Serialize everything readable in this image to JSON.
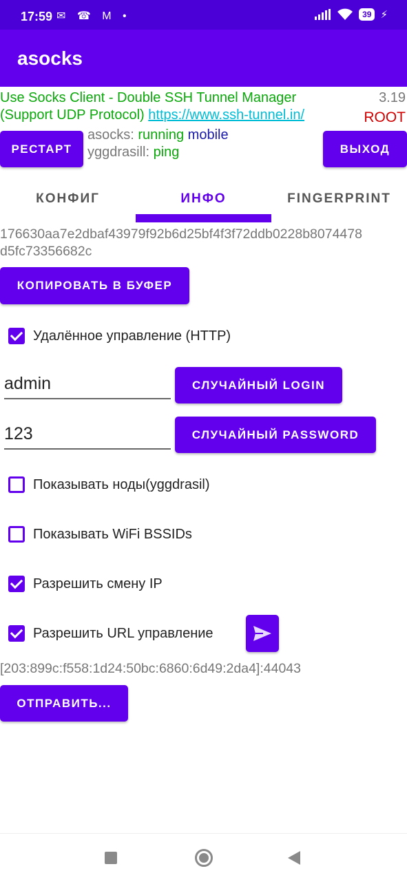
{
  "status_bar": {
    "time": "17:59",
    "notif_icons": "✉ ☎ M •",
    "battery": "39"
  },
  "app_bar": {
    "title": "asocks"
  },
  "header": {
    "line1": "Use Socks Client - Double SSH Tunnel Manager",
    "line2": "(Support UDP Protocol)",
    "link": "https://www.ssh-tunnel.in/",
    "version": "3.19",
    "root": "ROOT"
  },
  "controls": {
    "restart_label": "РЕСТАРТ",
    "exit_label": "ВЫХОД",
    "asocks_key": "asocks:",
    "asocks_status": "running",
    "asocks_net": "mobile",
    "ygg_key": "yggdrasill:",
    "ygg_status": "ping"
  },
  "tabs": [
    {
      "label": "КОНФИГ"
    },
    {
      "label": "ИНФО"
    },
    {
      "label": "FINGERPRINT"
    }
  ],
  "info": {
    "hash_line1": "176630aa7e2dbaf43979f92b6d25bf4f3f72ddb0228b8074478",
    "hash_line2": "d5fc73356682c",
    "copy_label": "КОПИРОВАТЬ В БУФЕР",
    "remote_http": "Удалённое управление (HTTP)",
    "login_value": "admin",
    "random_login_label": "СЛУЧАЙНЫЙ LOGIN",
    "password_value": "123",
    "random_password_label": "СЛУЧАЙНЫЙ PASSWORD",
    "show_nodes": "Показывать ноды(yggdrasil)",
    "show_bssids": "Показывать WiFi BSSIDs",
    "allow_ip_change": "Разрешить смену IP",
    "allow_url_control": "Разрешить URL управление",
    "address": "[203:899c:f558:1d24:50bc:6860:6d49:2da4]:44043",
    "send_label": "ОТПРАВИТЬ..."
  },
  "checkboxes": {
    "remote_http": true,
    "show_nodes": false,
    "show_bssids": false,
    "allow_ip_change": true,
    "allow_url_control": true
  },
  "colors": {
    "primary": "#6200ee",
    "status_bar": "#4a00d6",
    "green": "#0aa80a",
    "link": "#00bcd4",
    "root": "#d00000"
  }
}
